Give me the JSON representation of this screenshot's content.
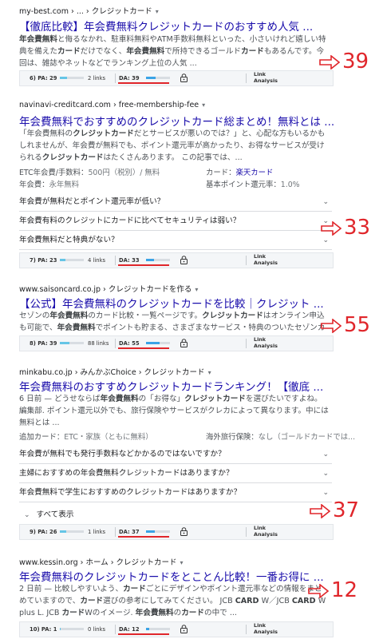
{
  "results": [
    {
      "crumb": "my-best.com › ... › クレジットカード",
      "title": "【徹底比較】年会費無料クレジットカードのおすすめ人気 ...",
      "snippet_html": "<b>年会費無料</b>と侮るなかれ、駐車料無料やATM手数料無料といった、小さいけれど嬉しい特典を備えた<b>カード</b>だけでなく、<b>年会費無料</b>で所持できるゴールド<b>カード</b>もあるんです。今回は、雑誌やネットなどでランキング上位の人気 ...",
      "bar": {
        "pa": "6) PA: 29",
        "pa_fill": 0.29,
        "links": "2 links",
        "da": "DA: 39",
        "da_fill": 0.39,
        "la": "Link\nAnalysis"
      },
      "annotation": "39"
    },
    {
      "crumb": "navinavi-creditcard.com › free-membership-fee",
      "title": "年会費無料でおすすめのクレジットカード総まとめ！無料とは ...",
      "snippet_html": "「年会費無料の<b>クレジットカード</b>だとサービスが悪いのでは？」と、心配な方もいるかもしれませんが、年会費が無料でも、ポイント還元率が高かったり、お得なサービスが受けられる<b>クレジットカード</b>はたくさんあります。 この記事では、...",
      "attrs": [
        {
          "k": "ETC年会費/手数料：",
          "v": "500円（税別）/ 無料"
        },
        {
          "k": "カード：",
          "v": "楽天カード",
          "link": true
        },
        {
          "k": "年会費：",
          "v": "永年無料"
        },
        {
          "k": "基本ポイント還元率：",
          "v": "1.0%"
        }
      ],
      "faqs": [
        "年会費が無料だとポイント還元率が低い？",
        "年会費有料のクレジットにカードに比べてセキュリティは弱い？",
        "年会費無料だと特典がない？"
      ],
      "bar": {
        "pa": "7) PA: 23",
        "pa_fill": 0.23,
        "links": "4 links",
        "da": "DA: 33",
        "da_fill": 0.33,
        "la": "Link\nAnalysis"
      },
      "annotation": "33"
    },
    {
      "crumb": "www.saisoncard.co.jp › クレジットカードを作る",
      "title": "【公式】年会費無料のクレジットカードを比較｜クレジット ...",
      "snippet_html": "セゾンの<b>年会費無料</b>のカード比較・一覧ページです。<b>クレジットカード</b>はオンライン申込も可能で、<b>年会費無料</b>でポイントも貯まる、さまざまなサービス・特典のついたセゾンカード。",
      "bar": {
        "pa": "8) PA: 39",
        "pa_fill": 0.39,
        "links": "88 links",
        "da": "DA: 55",
        "da_fill": 0.55,
        "la": "Link\nAnalysis"
      },
      "annotation": "55"
    },
    {
      "crumb": "minkabu.co.jp › みんかぶChoice › クレジットカード",
      "title": "年会費無料のおすすめクレジットカードランキング！【徹底 ...",
      "snippet_html": "6 日前 — どうせならば<b>年会費無料</b>の「お得な」<b>クレジットカード</b>を選びたいですよね。 編集部. ポイント還元以外でも、旅行保険やサービスがクレカによって異なります。中には無料とは ...",
      "attrs": [
        {
          "k": "追加カード：",
          "v": "ETC・家族（ともに無料）"
        },
        {
          "k": "海外旅行保険：",
          "v": "なし（ゴールドカードでは..."
        }
      ],
      "faqs": [
        "年会費が無料でも発行手数料などかかるのではないですか？",
        "主婦におすすめの年会費無料クレジットカードはありますか？",
        "年会費無料で学生におすすめのクレジットカードはありますか？"
      ],
      "show_all": "すべて表示",
      "bar": {
        "pa": "9) PA: 26",
        "pa_fill": 0.26,
        "links": "1 links",
        "da": "DA: 37",
        "da_fill": 0.37,
        "la": "Link\nAnalysis"
      },
      "annotation": "37"
    },
    {
      "crumb": "www.kessin.org › ホーム › クレジットカード",
      "title": "年会費無料のクレジットカードをとことん比較！一番お得に ...",
      "snippet_html": "2 日前 — 比較しやすいよう、<b>カード</b>ごとにデザインやポイント還元率などの情報をまとめていますので、<b>カード</b>選びの参考にしてみてください。 JCB <b>CARD</b> W／JCB <b>CARD</b> W plus L. JCB <b>カード</b>Wのイメージ. <b>年会費無料</b>の<b>カード</b>の中で ...",
      "bar": {
        "pa": "10) PA: 1",
        "pa_fill": 0.01,
        "links": "0 links",
        "da": "DA: 12",
        "da_fill": 0.12,
        "la": "Link\nAnalysis"
      },
      "annotation": "12"
    }
  ],
  "colors": {
    "title": "#1a0dab",
    "annotation": "#e0262b",
    "pa_bar": "#65c5e6",
    "da_bar": "#3aa3e6"
  }
}
